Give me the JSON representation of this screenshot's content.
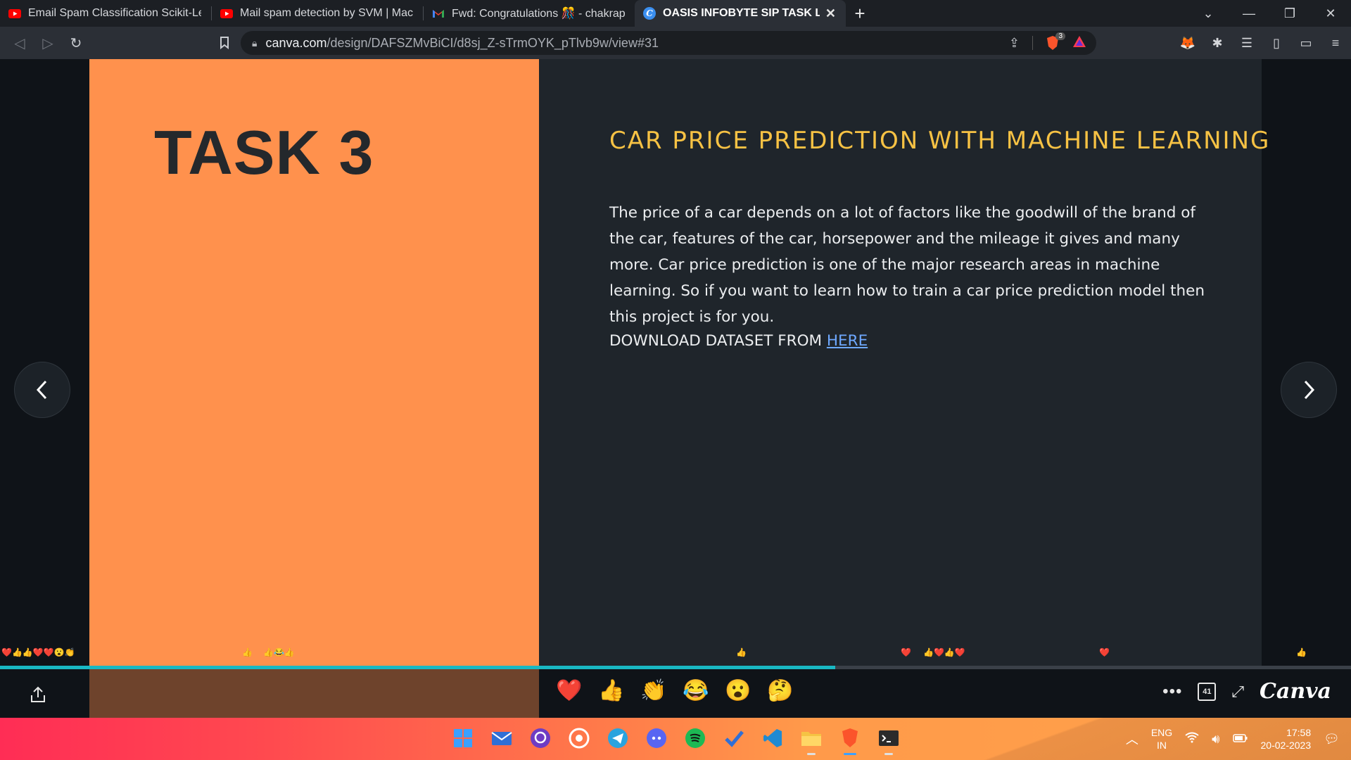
{
  "tabs": [
    {
      "title": "Email Spam Classification Scikit-Learn",
      "icon": "youtube-icon"
    },
    {
      "title": "Mail spam detection by SVM | Machine",
      "icon": "youtube-icon"
    },
    {
      "title": "Fwd: Congratulations 🎊 - chakrapani",
      "icon": "gmail-icon"
    },
    {
      "title": "OASIS INFOBYTE SIP TASK LIST",
      "icon": "canva-icon",
      "active": true
    }
  ],
  "address": {
    "host": "canva.com",
    "path": "/design/DAFSZMvBiCI/d8sj_Z-sTrmOYK_pTlvb9w/view#31"
  },
  "brave_badge": "3",
  "slide": {
    "task_title": "TASK 3",
    "heading": "CAR PRICE PREDICTION WITH MACHINE LEARNING",
    "body": "The price of a car depends on a lot of factors like the goodwill of the brand of the car, features of the car, horsepower and the mileage it gives and many more. Car price prediction is one of the major research areas in machine learning. So if you want to learn how to train a car price prediction model then this project is for you.",
    "download_prefix": "DOWNLOAD DATASET FROM ",
    "download_link": "HERE"
  },
  "progress_fraction": 0.618,
  "reactions": [
    "❤️",
    "👍",
    "👏",
    "😂",
    "😮",
    "🤔"
  ],
  "page_count": "41",
  "brand": "Canva",
  "taskbar": {
    "lang_top": "ENG",
    "lang_bottom": "IN",
    "time": "17:58",
    "date": "20-02-2023"
  },
  "colors": {
    "slide_left": "#ff914d",
    "slide_right": "#1f252b",
    "heading": "#f7c244",
    "progress": "#19b8c3"
  }
}
